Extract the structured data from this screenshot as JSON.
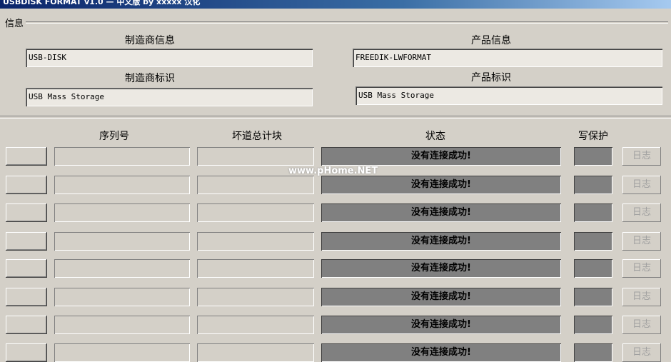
{
  "window": {
    "title": "USBDISK FORMAT v1.0 — 中文版 by xxxxx 汉化"
  },
  "info": {
    "legend": "信息",
    "manufacturer_info_label": "制造商信息",
    "manufacturer_info_value": "USB-DISK",
    "product_info_label": "产品信息",
    "product_info_value": "FREEDIK-LWFORMAT",
    "manufacturer_id_label": "制造商标识",
    "manufacturer_id_value": "USB Mass Storage",
    "product_id_label": "产品标识",
    "product_id_value": "USB Mass Storage"
  },
  "table": {
    "headers": {
      "serial": "序列号",
      "bad_blocks": "坏道总计块",
      "status": "状态",
      "write_protect": "写保护"
    },
    "rows": [
      {
        "status": "没有连接成功!",
        "log": "日志"
      },
      {
        "status": "没有连接成功!",
        "log": "日志"
      },
      {
        "status": "没有连接成功!",
        "log": "日志"
      },
      {
        "status": "没有连接成功!",
        "log": "日志"
      },
      {
        "status": "没有连接成功!",
        "log": "日志"
      },
      {
        "status": "没有连接成功!",
        "log": "日志"
      },
      {
        "status": "没有连接成功!",
        "log": "日志"
      },
      {
        "status": "没有连接成功!",
        "log": "日志"
      }
    ]
  },
  "watermark": "www.pHome.NET"
}
